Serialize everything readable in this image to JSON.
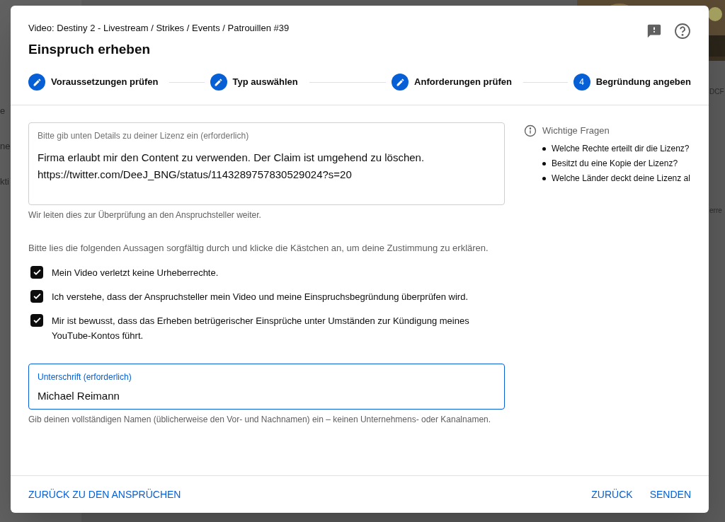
{
  "background": {
    "left_fragments": [
      "e",
      "ne",
      "kti"
    ],
    "right_fragments": [
      "DCF",
      "erre"
    ],
    "thumbnail": {
      "kind": "picture"
    }
  },
  "dialog": {
    "breadcrumb": "Video: Destiny 2 - Livestream / Strikes / Events / Patrouillen #39",
    "title": "Einspruch erheben",
    "steps": [
      {
        "kind": "done",
        "label": "Voraussetzungen prüfen"
      },
      {
        "kind": "done",
        "label": "Typ auswählen"
      },
      {
        "kind": "done",
        "label": "Anforderungen prüfen"
      },
      {
        "kind": "current",
        "number": "4",
        "label": "Begründung angeben"
      }
    ],
    "license_field": {
      "label": "Bitte gib unten Details zu deiner Lizenz ein (erforderlich)",
      "lines": [
        "Firma erlaubt mir den Content zu verwenden. Der Claim ist umgehend zu löschen.",
        "https://twitter.com/DeeJ_BNG/status/1143289757830529024?s=20"
      ],
      "helper": "Wir leiten dies zur Überprüfung an den Anspruchsteller weiter."
    },
    "agreement_intro": "Bitte lies die folgenden Aussagen sorgfältig durch und klicke die Kästchen an, um deine Zustimmung zu erklären.",
    "statements": [
      {
        "text": "Mein Video verletzt keine Urheberrechte.",
        "checked": true
      },
      {
        "text": "Ich verstehe, dass der Anspruchsteller mein Video und meine Einspruchsbegründung überprüfen wird.",
        "checked": true
      },
      {
        "text": "Mir ist bewusst, dass das Erheben betrügerischer Einsprüche unter Umständen zur Kündigung meines YouTube-Kontos führt.",
        "checked": true
      }
    ],
    "signature_field": {
      "label": "Unterschrift (erforderlich)",
      "value": "Michael Reimann",
      "helper": "Gib deinen vollständigen Namen (üblicherweise den Vor- und Nachnamen) ein – keinen Unternehmens- oder Kanalnamen."
    },
    "questions": {
      "title": "Wichtige Fragen",
      "items": [
        "Welche Rechte erteilt dir die Lizenz?",
        "Besitzt du eine Kopie der Lizenz?",
        "Welche Länder deckt deine Lizenz al"
      ]
    },
    "footer": {
      "left_button": "ZURÜCK ZU DEN ANSPRÜCHEN",
      "buttons": [
        "ZURÜCK",
        "SENDEN"
      ]
    }
  }
}
